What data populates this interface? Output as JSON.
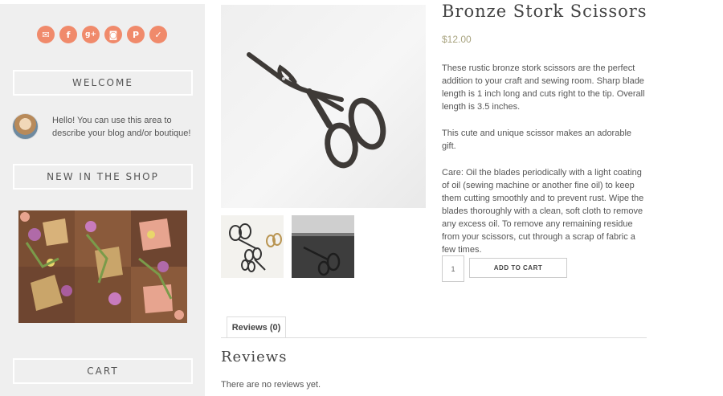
{
  "sidebar": {
    "social": [
      {
        "icon": "email-icon",
        "glyph": "✉"
      },
      {
        "icon": "facebook-icon",
        "glyph": "f"
      },
      {
        "icon": "google-plus-icon",
        "glyph": "g+"
      },
      {
        "icon": "instagram-icon",
        "glyph": "◙"
      },
      {
        "icon": "pinterest-icon",
        "glyph": "P"
      },
      {
        "icon": "twitter-icon",
        "glyph": "✓"
      }
    ],
    "welcome_heading": "WELCOME",
    "about_text": "Hello! You can use this area to describe your blog and/or boutique!",
    "new_in_shop_heading": "NEW IN THE SHOP",
    "cart_heading": "CART"
  },
  "product": {
    "title": "Bronze Stork Scissors",
    "price": "$12.00",
    "description": [
      "These rustic bronze stork scissors are the perfect addition to your craft and sewing room. Sharp blade length is 1 inch long and cuts right to the tip. Overall length is 3.5 inches.",
      "This cute and unique scissor makes an adorable gift.",
      "Care: Oil the blades periodically with a light coating of oil (sewing machine or another fine oil) to keep them cutting smoothly and to prevent rust. Wipe the blades thoroughly with a clean, soft cloth to remove any excess oil. To remove any remaining residue from your scissors, cut through a scrap of fabric a few times."
    ],
    "quantity": "1",
    "add_to_cart_label": "ADD TO CART"
  },
  "tabs": {
    "reviews_tab_label": "Reviews (0)",
    "reviews_heading": "Reviews",
    "no_reviews_text": "There are no reviews yet."
  },
  "colors": {
    "accent": "#f08a6b",
    "price": "#a8a37f",
    "sidebar_bg": "#efefef"
  }
}
